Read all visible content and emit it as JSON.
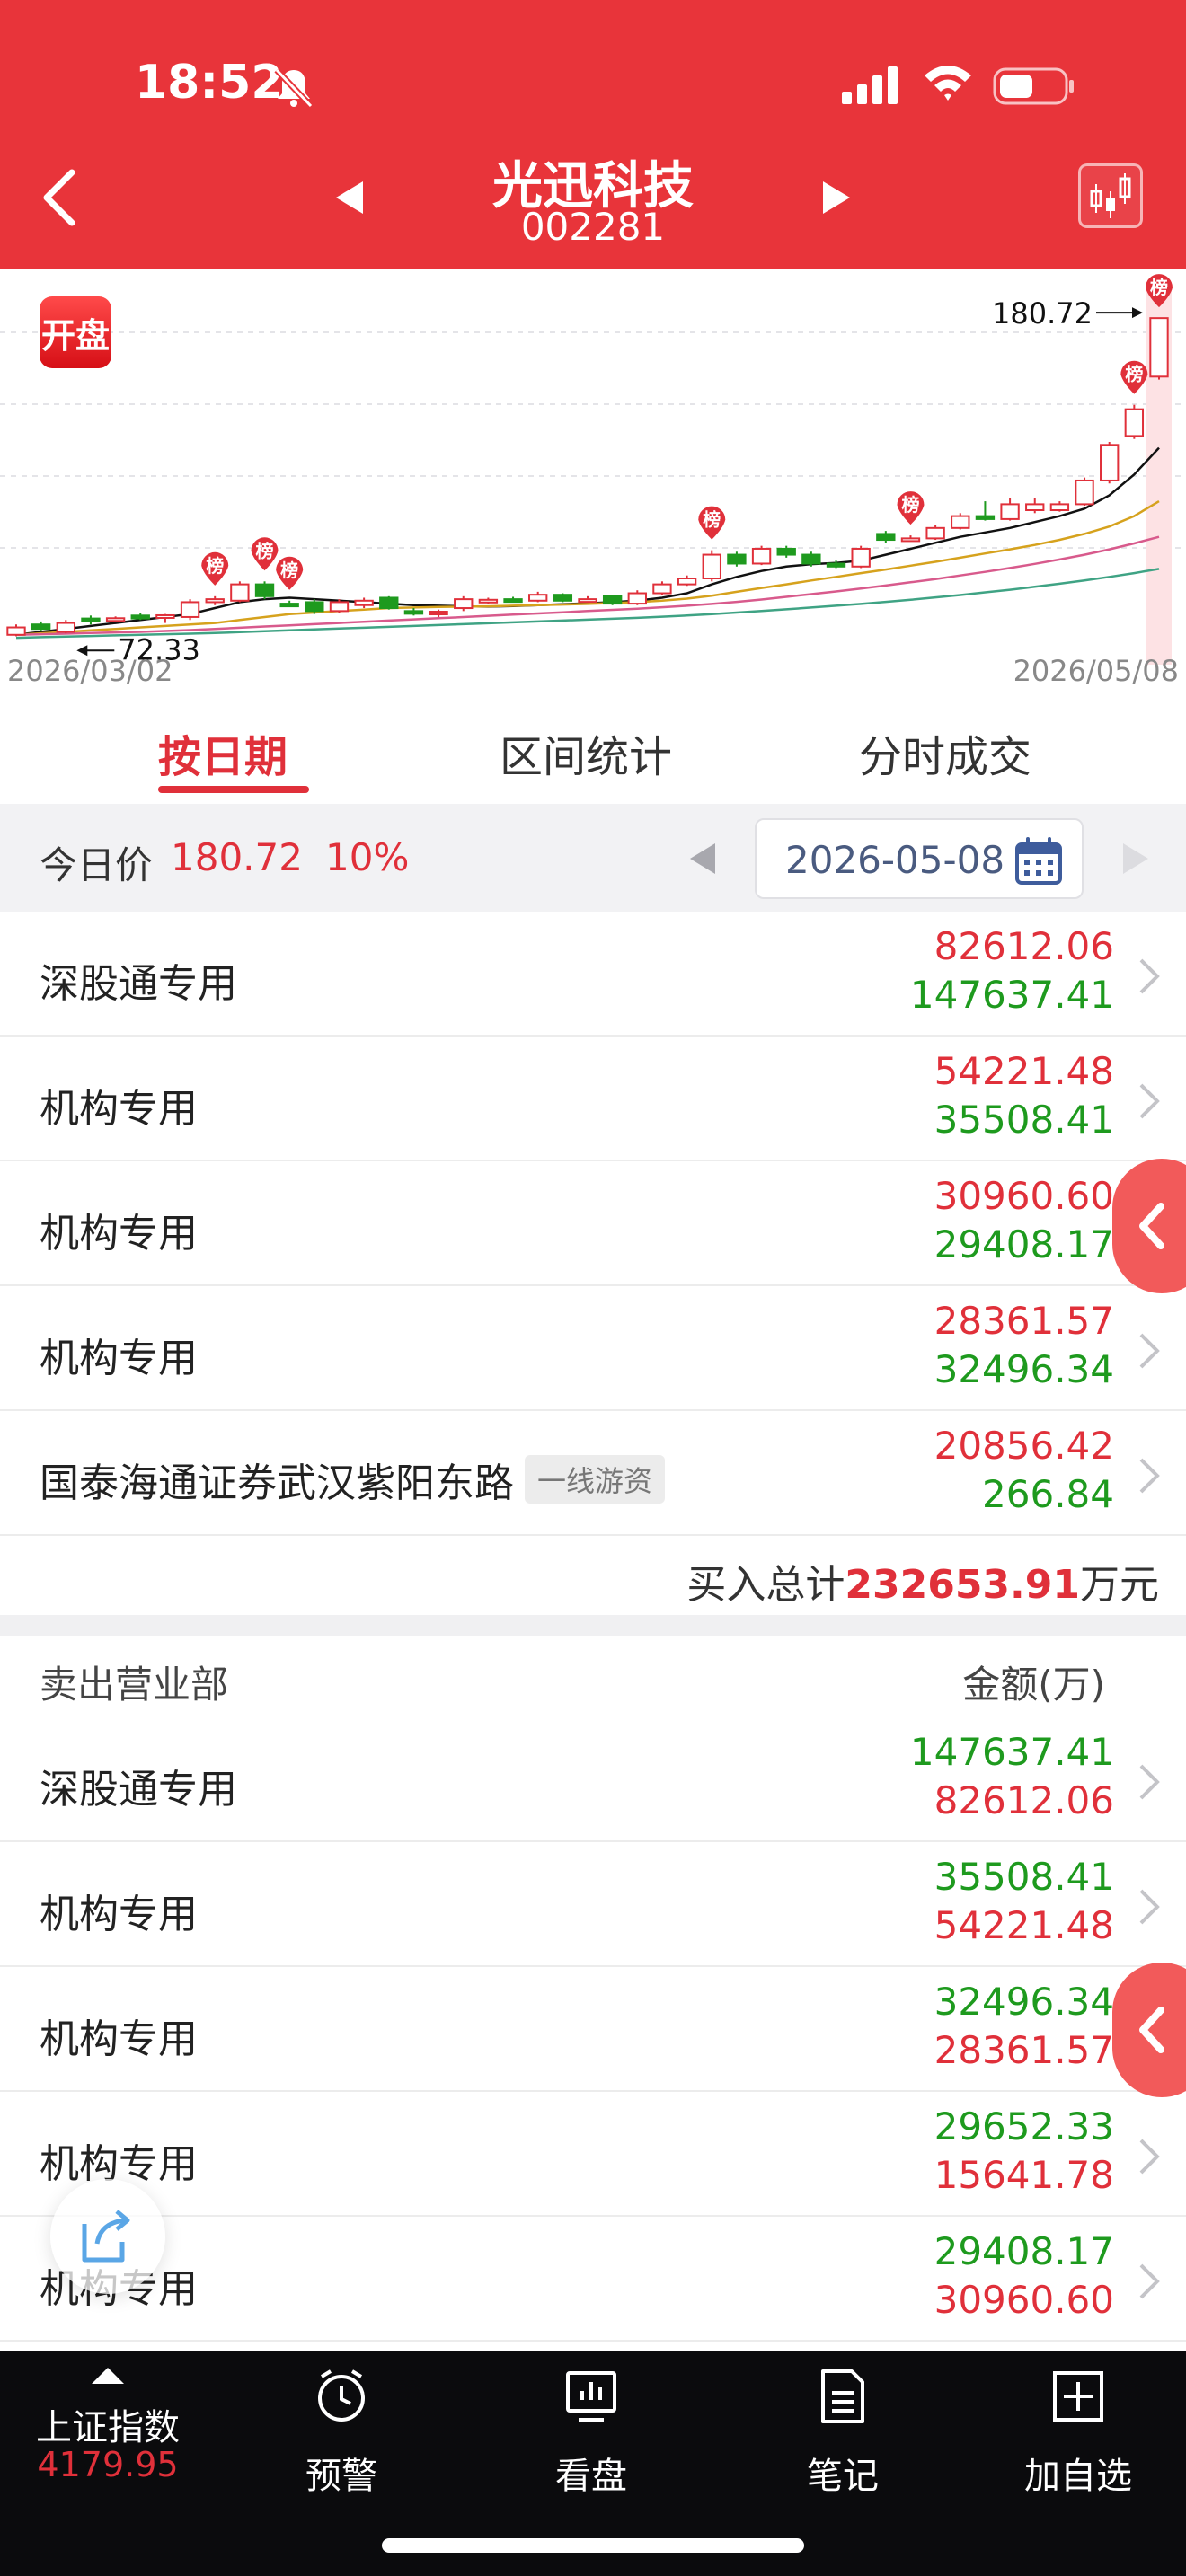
{
  "status_bar": {
    "time": "18:52"
  },
  "header": {
    "stock_name": "光迅科技",
    "stock_code": "002281"
  },
  "chart": {
    "badge_label": "开盘",
    "rank_marker": "榜",
    "date_start": "2026/03/02",
    "date_end": "2026/05/08",
    "low_label": "72.33",
    "high_label": "180.72"
  },
  "chart_data": {
    "type": "candlestick",
    "x_range": [
      "2026/03/02",
      "2026/05/08"
    ],
    "low": 72.33,
    "high": 180.72,
    "ylim": [
      70,
      185
    ],
    "candles": [
      {
        "o": 74,
        "c": 76.5,
        "h": 77.5,
        "l": 73.5,
        "up": true
      },
      {
        "o": 76,
        "c": 77.5,
        "h": 78.5,
        "l": 75.5,
        "up": false
      },
      {
        "o": 75,
        "c": 78,
        "h": 79,
        "l": 74.5,
        "up": true
      },
      {
        "o": 78.5,
        "c": 79.5,
        "h": 80.5,
        "l": 77.5,
        "up": false
      },
      {
        "o": 79,
        "c": 79.6,
        "h": 80.2,
        "l": 78.5,
        "up": true
      },
      {
        "o": 79.5,
        "c": 80.5,
        "h": 81.5,
        "l": 79,
        "up": false
      },
      {
        "o": 80.5,
        "c": 80.6,
        "h": 81,
        "l": 78,
        "up": true
      },
      {
        "o": 80,
        "c": 85,
        "h": 86,
        "l": 79,
        "up": true
      },
      {
        "o": 85,
        "c": 86,
        "h": 87,
        "l": 84,
        "up": true
      },
      {
        "o": 85.5,
        "c": 91,
        "h": 92,
        "l": 85,
        "up": true
      },
      {
        "o": 91,
        "c": 87,
        "h": 92,
        "l": 86,
        "up": false
      },
      {
        "o": 84,
        "c": 84.5,
        "h": 85.5,
        "l": 83.5,
        "up": false
      },
      {
        "o": 85,
        "c": 82,
        "h": 86,
        "l": 81,
        "up": false
      },
      {
        "o": 82,
        "c": 85,
        "h": 86,
        "l": 81.5,
        "up": true
      },
      {
        "o": 84,
        "c": 85.5,
        "h": 86.5,
        "l": 83,
        "up": true
      },
      {
        "o": 86.5,
        "c": 83,
        "h": 87,
        "l": 82.5,
        "up": false
      },
      {
        "o": 82,
        "c": 81.5,
        "h": 83,
        "l": 80.5,
        "up": false
      },
      {
        "o": 81.5,
        "c": 81.8,
        "h": 82.5,
        "l": 80,
        "up": true
      },
      {
        "o": 83,
        "c": 86,
        "h": 87,
        "l": 82,
        "up": true
      },
      {
        "o": 85.5,
        "c": 85.8,
        "h": 86.5,
        "l": 84.5,
        "up": true
      },
      {
        "o": 86,
        "c": 85.7,
        "h": 86.8,
        "l": 85,
        "up": false
      },
      {
        "o": 85.5,
        "c": 87.5,
        "h": 88.5,
        "l": 85,
        "up": true
      },
      {
        "o": 87.5,
        "c": 85.5,
        "h": 88,
        "l": 85,
        "up": false
      },
      {
        "o": 85.5,
        "c": 86,
        "h": 87,
        "l": 85,
        "up": true
      },
      {
        "o": 87,
        "c": 84.5,
        "h": 87.5,
        "l": 84,
        "up": false
      },
      {
        "o": 84.5,
        "c": 88,
        "h": 89,
        "l": 84,
        "up": true
      },
      {
        "o": 88,
        "c": 91,
        "h": 92,
        "l": 87.5,
        "up": true
      },
      {
        "o": 91,
        "c": 93,
        "h": 94,
        "l": 90.5,
        "up": true
      },
      {
        "o": 93,
        "c": 101,
        "h": 102.5,
        "l": 92,
        "up": true
      },
      {
        "o": 101,
        "c": 98,
        "h": 102,
        "l": 97,
        "up": false
      },
      {
        "o": 98,
        "c": 103,
        "h": 104,
        "l": 97.5,
        "up": true
      },
      {
        "o": 103,
        "c": 101,
        "h": 104,
        "l": 100,
        "up": false
      },
      {
        "o": 101,
        "c": 98,
        "h": 102,
        "l": 97,
        "up": false
      },
      {
        "o": 98,
        "c": 97,
        "h": 99,
        "l": 96.5,
        "up": false
      },
      {
        "o": 97,
        "c": 103,
        "h": 104,
        "l": 96.5,
        "up": true
      },
      {
        "o": 108,
        "c": 106,
        "h": 109,
        "l": 105,
        "up": false
      },
      {
        "o": 106,
        "c": 106.5,
        "h": 107.5,
        "l": 105.5,
        "up": true
      },
      {
        "o": 106.5,
        "c": 110,
        "h": 111,
        "l": 106,
        "up": true
      },
      {
        "o": 110,
        "c": 114,
        "h": 115,
        "l": 109.5,
        "up": true
      },
      {
        "o": 114,
        "c": 113,
        "h": 119,
        "l": 112.5,
        "up": false
      },
      {
        "o": 113,
        "c": 118,
        "h": 120,
        "l": 112.5,
        "up": true
      },
      {
        "o": 118,
        "c": 116,
        "h": 120,
        "l": 115,
        "up": true
      },
      {
        "o": 116,
        "c": 118,
        "h": 119,
        "l": 115.5,
        "up": true
      },
      {
        "o": 118,
        "c": 126,
        "h": 127,
        "l": 117.5,
        "up": true
      },
      {
        "o": 126,
        "c": 138,
        "h": 139,
        "l": 125,
        "up": true
      },
      {
        "o": 141,
        "c": 150,
        "h": 151.5,
        "l": 140,
        "up": true
      },
      {
        "o": 161,
        "c": 180.72,
        "h": 180.72,
        "l": 160,
        "up": true
      }
    ],
    "rank_days": [
      8,
      10,
      11,
      28,
      36,
      45,
      46
    ],
    "moving_averages": [
      {
        "color": "#111111",
        "values": [
          74,
          75,
          76,
          77,
          78,
          79,
          80,
          81,
          83,
          85,
          86,
          86.5,
          86,
          85.5,
          85,
          84.5,
          84,
          83.8,
          83.6,
          83.5,
          83.7,
          84,
          84.3,
          84.6,
          85,
          85.5,
          86.5,
          88,
          91,
          93.5,
          95.5,
          97,
          97.8,
          98.2,
          99,
          101,
          103,
          105,
          107,
          108.5,
          110,
          112,
          114,
          116.5,
          121,
          128,
          137
        ]
      },
      {
        "color": "#d6a21d",
        "values": [
          74,
          74.5,
          75,
          75.5,
          76,
          76.5,
          77,
          77.5,
          78,
          79,
          80,
          81,
          81.5,
          82,
          82.5,
          83,
          83.2,
          83.4,
          83.5,
          83.6,
          83.8,
          84,
          84.2,
          84.4,
          84.7,
          85,
          85.5,
          86.2,
          87.2,
          88.5,
          89.8,
          91,
          92.3,
          93.5,
          94.8,
          96,
          97.3,
          98.6,
          100,
          101.4,
          102.8,
          104.3,
          106,
          108,
          110.5,
          114,
          119
        ]
      },
      {
        "color": "#d85a8c",
        "values": [
          74,
          74.2,
          74.4,
          74.6,
          74.8,
          75,
          75.3,
          75.6,
          76,
          76.4,
          76.8,
          77.2,
          77.6,
          78,
          78.4,
          78.8,
          79.2,
          79.6,
          80,
          80.4,
          80.8,
          81.2,
          81.6,
          82,
          82.4,
          82.8,
          83.3,
          83.8,
          84.4,
          85.1,
          85.9,
          86.8,
          87.7,
          88.6,
          89.6,
          90.6,
          91.7,
          92.8,
          94,
          95.2,
          96.5,
          97.9,
          99.4,
          101,
          102.8,
          104.8,
          107
        ]
      },
      {
        "color": "#3fa384",
        "values": [
          73,
          73.2,
          73.4,
          73.6,
          73.8,
          74,
          74.2,
          74.4,
          74.6,
          74.9,
          75.2,
          75.5,
          75.8,
          76.1,
          76.4,
          76.7,
          77,
          77.3,
          77.6,
          77.9,
          78.2,
          78.5,
          78.8,
          79.1,
          79.4,
          79.7,
          80.1,
          80.5,
          81,
          81.5,
          82,
          82.6,
          83.2,
          83.8,
          84.4,
          85.1,
          85.8,
          86.6,
          87.4,
          88.3,
          89.2,
          90.2,
          91.2,
          92.3,
          93.5,
          94.8,
          96.2
        ]
      }
    ]
  },
  "tabs": [
    {
      "label": "按日期",
      "active": true
    },
    {
      "label": "区间统计",
      "active": false
    },
    {
      "label": "分时成交",
      "active": false
    }
  ],
  "price_bar": {
    "label": "今日价",
    "price": "180.72",
    "change": "10%",
    "date": "2026-05-08"
  },
  "buy_rows": [
    {
      "name": "深股通专用",
      "tag": "",
      "top": "82612.06",
      "bottom": "147637.41"
    },
    {
      "name": "机构专用",
      "tag": "",
      "top": "54221.48",
      "bottom": "35508.41"
    },
    {
      "name": "机构专用",
      "tag": "",
      "top": "30960.60",
      "bottom": "29408.17"
    },
    {
      "name": "机构专用",
      "tag": "",
      "top": "28361.57",
      "bottom": "32496.34"
    },
    {
      "name": "国泰海通证券武汉紫阳东路",
      "tag": "一线游资",
      "top": "20856.42",
      "bottom": "266.84"
    }
  ],
  "buy_total": {
    "label": "买入总计",
    "value": "232653.91",
    "unit": "万元"
  },
  "sell_header": {
    "label": "卖出营业部",
    "unit": "金额(万)"
  },
  "sell_rows": [
    {
      "name": "深股通专用",
      "top": "147637.41",
      "bottom": "82612.06"
    },
    {
      "name": "机构专用",
      "top": "35508.41",
      "bottom": "54221.48"
    },
    {
      "name": "机构专用",
      "top": "32496.34",
      "bottom": "28361.57"
    },
    {
      "name": "机构专用",
      "top": "29652.33",
      "bottom": "15641.78"
    },
    {
      "name": "机构专用",
      "top": "29408.17",
      "bottom": "30960.60"
    }
  ],
  "bottom_nav": {
    "index_name": "上证指数",
    "index_value": "4179.95",
    "items": [
      "预警",
      "看盘",
      "笔记",
      "加自选"
    ]
  },
  "colors": {
    "header_red": "#e8343a",
    "up_red": "#e0303a",
    "down_green": "#1e9a1e"
  }
}
